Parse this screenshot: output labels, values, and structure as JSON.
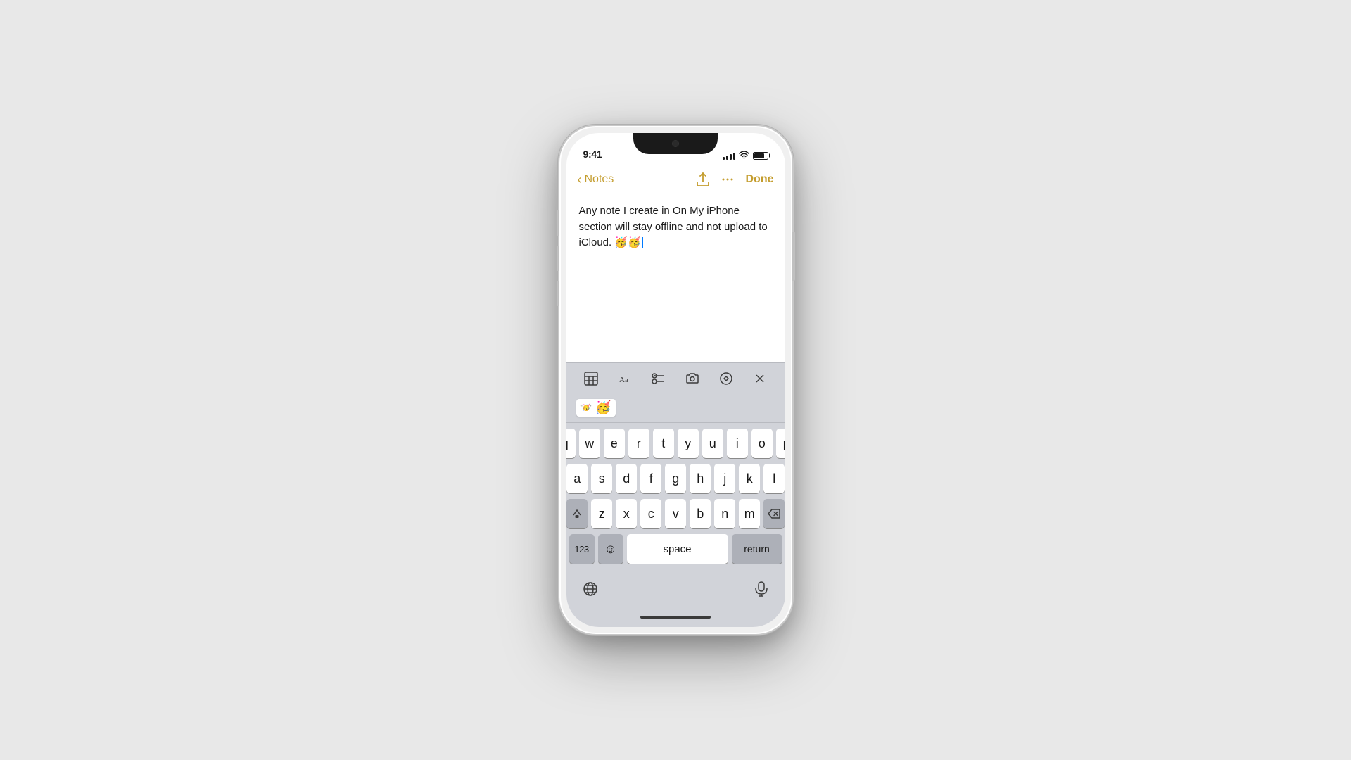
{
  "background": "#e8e8e8",
  "phone": {
    "status_bar": {
      "time": "9:41",
      "signal": [
        3,
        5,
        7,
        9,
        11
      ],
      "battery_level": 80
    },
    "nav": {
      "back_label": "Notes",
      "done_label": "Done"
    },
    "note": {
      "text": "Any note I create in On My iPhone section will stay offline and not upload to iCloud. 🥳🥳"
    },
    "toolbar": {
      "icons": [
        "table",
        "format",
        "checklist",
        "camera",
        "markup",
        "close"
      ]
    },
    "emoji_bar": {
      "suggestion": "🥳",
      "label": "\"🥳\""
    },
    "keyboard": {
      "rows": [
        [
          "q",
          "w",
          "e",
          "r",
          "t",
          "y",
          "u",
          "i",
          "o",
          "p"
        ],
        [
          "a",
          "s",
          "d",
          "f",
          "g",
          "h",
          "j",
          "k",
          "l"
        ],
        [
          "⇧",
          "z",
          "x",
          "c",
          "v",
          "b",
          "n",
          "m",
          "⌫"
        ]
      ],
      "bottom_row": {
        "num_label": "123",
        "emoji_label": "😊",
        "space_label": "space",
        "return_label": "return"
      }
    }
  }
}
